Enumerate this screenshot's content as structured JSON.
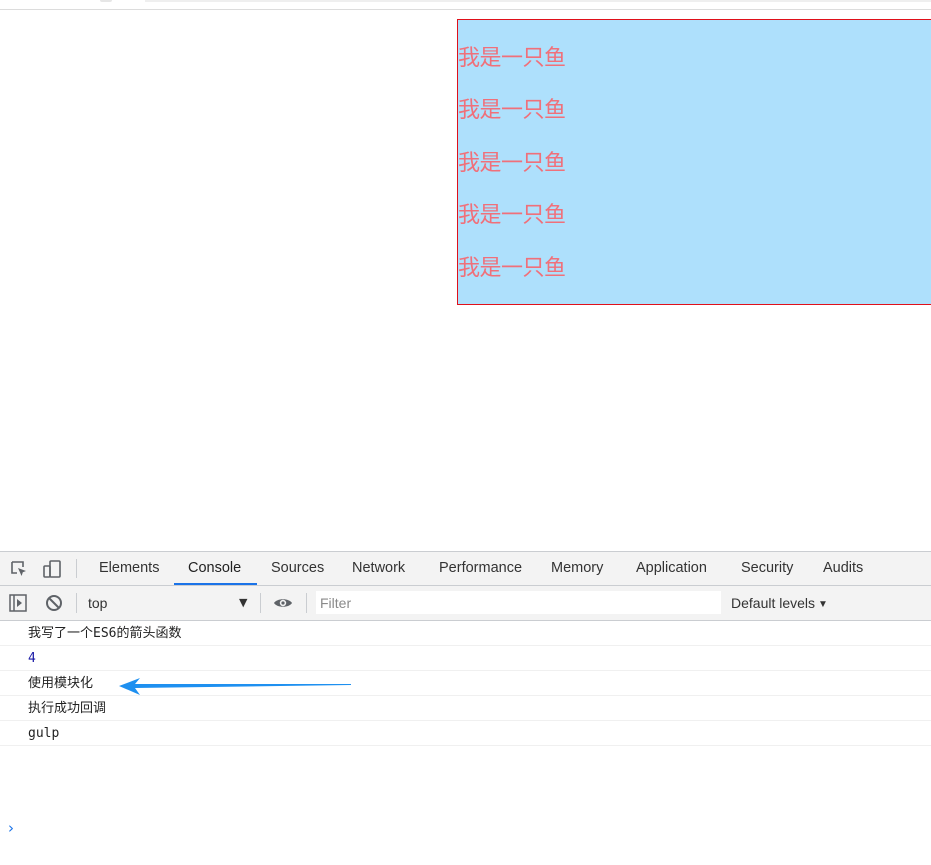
{
  "page": {
    "fish_lines": [
      "我是一只鱼",
      "我是一只鱼",
      "我是一只鱼",
      "我是一只鱼",
      "我是一只鱼"
    ],
    "colors": {
      "box_bg": "#aee0fc",
      "box_border": "#e0101a",
      "fish_text": "#f0707a"
    }
  },
  "devtools": {
    "tabs": [
      {
        "label": "Elements",
        "active": false
      },
      {
        "label": "Console",
        "active": true
      },
      {
        "label": "Sources",
        "active": false
      },
      {
        "label": "Network",
        "active": false
      },
      {
        "label": "Performance",
        "active": false
      },
      {
        "label": "Memory",
        "active": false
      },
      {
        "label": "Application",
        "active": false
      },
      {
        "label": "Security",
        "active": false
      },
      {
        "label": "Audits",
        "active": false
      }
    ],
    "icons": [
      "inspect-element-icon",
      "device-toolbar-icon",
      "show-sidebar-icon",
      "clear-console-icon",
      "live-expression-eye-icon"
    ],
    "console_toolbar": {
      "context": "top",
      "filter_placeholder": "Filter",
      "levels": "Default levels"
    },
    "console_messages": [
      {
        "text": "我写了一个ES6的箭头函数",
        "type": "string"
      },
      {
        "text": "4",
        "type": "number"
      },
      {
        "text": "使用模块化",
        "type": "string"
      },
      {
        "text": "执行成功回调",
        "type": "string"
      },
      {
        "text": "gulp",
        "type": "string"
      }
    ],
    "prompt": "›",
    "accent_color": "#1a73e8"
  },
  "annotation": {
    "arrow_color": "#1e90f0"
  }
}
